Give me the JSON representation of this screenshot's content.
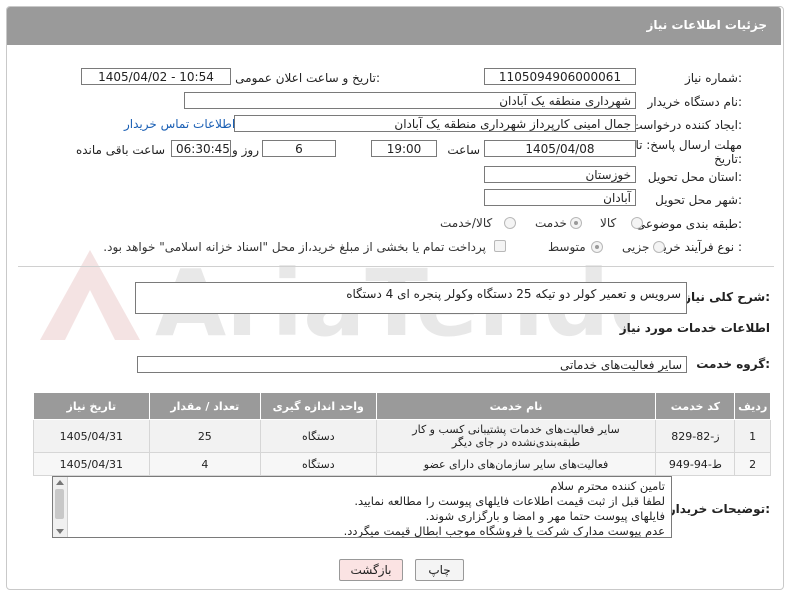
{
  "header": {
    "title": "جزئیات اطلاعات نیاز"
  },
  "form": {
    "need_number_label": "شماره نیاز:",
    "need_number": "1105094906000061",
    "announce_label": "تاریخ و ساعت اعلان عمومی:",
    "announce_value": "1405/04/02 - 10:54",
    "buyer_org_label": "نام دستگاه خریدار:",
    "buyer_org": "شهرداری منطقه یک آبادان",
    "creator_label": "ایجاد کننده درخواست:",
    "creator": "جمال امینی کارپرداز شهرداری منطقه یک آبادان",
    "contact_link": "اطلاعات تماس خریدار",
    "deadline_label_1": "مهلت ارسال پاسخ: تا",
    "deadline_label_2": "تاریخ:",
    "deadline_date": "1405/04/08",
    "time_label": "ساعت",
    "deadline_time": "19:00",
    "days": "6",
    "days_label": "روز و",
    "remaining": "06:30:45",
    "remaining_label": "ساعت باقی مانده",
    "province_label": "استان محل تحویل:",
    "province": "خوزستان",
    "city_label": "شهر محل تحویل:",
    "city": "آبادان",
    "category_label": "طبقه بندی موضوعی:",
    "category_options": [
      "کالا",
      "خدمت",
      "کالا/خدمت"
    ],
    "category_selected": "خدمت",
    "process_label": "نوع فرآیند خرید :",
    "process_options": [
      "جزیی",
      "متوسط"
    ],
    "process_selected": "متوسط",
    "payment_note": "پرداخت تمام یا بخشی از مبلغ خرید،از محل \"اسناد خزانه اسلامی\" خواهد بود."
  },
  "summary": {
    "label": "شرح کلی نیاز:",
    "text": "سرویس و تعمیر کولر دو تیکه 25 دستگاه وکولر  پنجره ای 4 دستگاه"
  },
  "services": {
    "section_title": "اطلاعات خدمات مورد نیاز",
    "group_label": "گروه خدمت:",
    "group_value": "سایر فعالیت‌های خدماتی",
    "columns": [
      "ردیف",
      "کد خدمت",
      "نام خدمت",
      "واحد اندازه گیری",
      "تعداد / مقدار",
      "تاریخ نیاز"
    ],
    "rows": [
      {
        "index": "1",
        "code": "ز-82-829",
        "name": "سایر فعالیت‌های خدمات پشتیبانی کسب و کار طبقه‌بندی‌نشده در جای دیگر",
        "unit": "دستگاه",
        "qty": "25",
        "date": "1405/04/31"
      },
      {
        "index": "2",
        "code": "ط-94-949",
        "name": "فعالیت‌های سایر سازمان‌های دارای عضو",
        "unit": "دستگاه",
        "qty": "4",
        "date": "1405/04/31"
      }
    ]
  },
  "notes": {
    "label": "توضیحات خریدار:",
    "lines": [
      "تامین کننده محترم سلام",
      "لطفا قبل از ثبت قیمت اطلاعات فایلهای پیوست را مطالعه نمایید.",
      "فایلهای پیوست حتما مهر و امضا و بارگزاری شوند.",
      "عدم پیوست مدارک شرکت یا فروشگاه موجب ابطال قیمت میگردد."
    ]
  },
  "buttons": {
    "print": "چاپ",
    "back": "بازگشت"
  },
  "watermark": {
    "text": "AriaTender.net"
  }
}
